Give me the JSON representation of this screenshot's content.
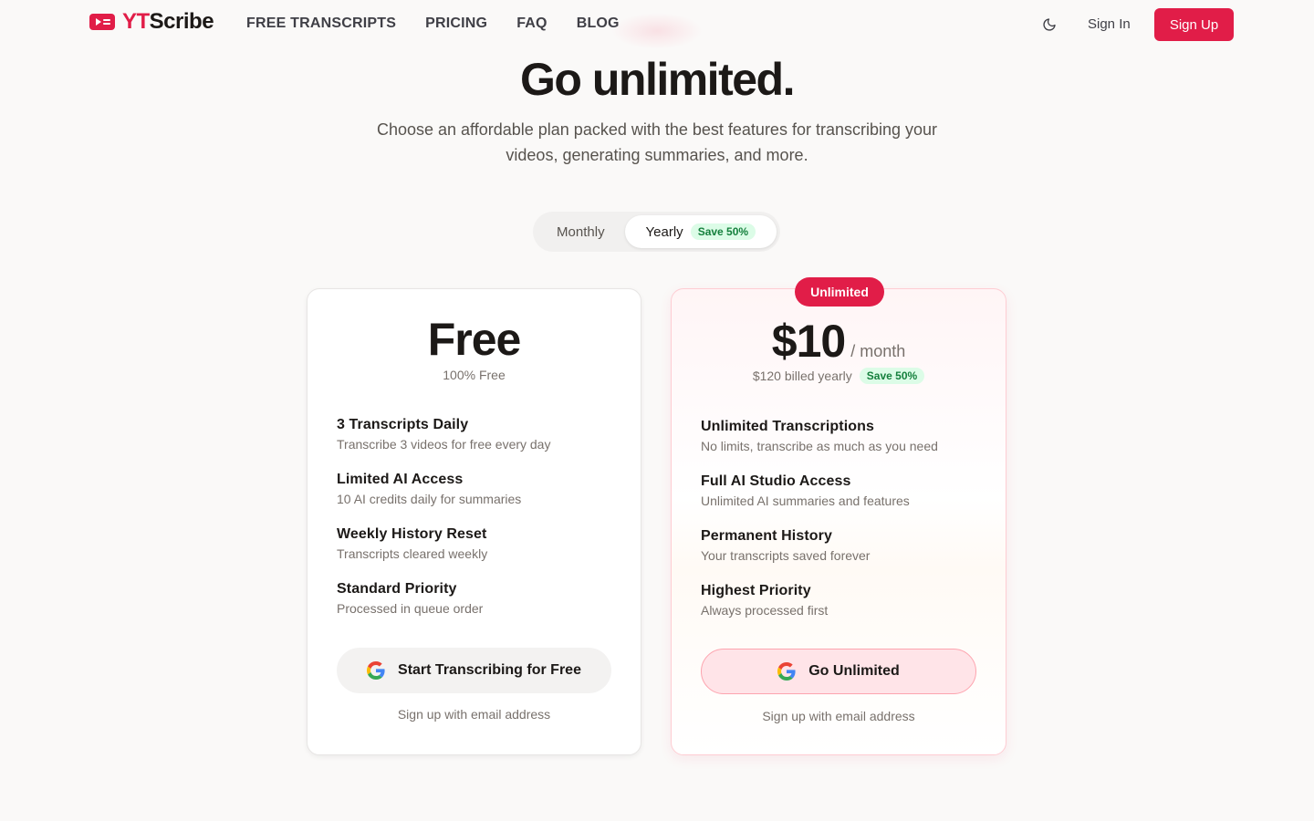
{
  "brand": {
    "name_part1": "YT",
    "name_part2": "Scribe",
    "accent": "#e11d48"
  },
  "nav": {
    "items": [
      "FREE TRANSCRIPTS",
      "PRICING",
      "FAQ",
      "BLOG"
    ]
  },
  "header": {
    "theme_icon": "moon-icon",
    "signin_label": "Sign In",
    "signup_label": "Sign Up"
  },
  "hero": {
    "title": "Go unlimited.",
    "subtitle": "Choose an affordable plan packed with the best features for transcribing your videos, generating summaries, and more."
  },
  "billing_toggle": {
    "monthly": "Monthly",
    "yearly": "Yearly",
    "yearly_badge": "Save 50%",
    "selected": "Yearly"
  },
  "plans": {
    "free": {
      "name": "Free",
      "subtitle": "100% Free",
      "features": [
        {
          "title": "3 Transcripts Daily",
          "desc": "Transcribe 3 videos for free every day"
        },
        {
          "title": "Limited AI Access",
          "desc": "10 AI credits daily for summaries"
        },
        {
          "title": "Weekly History Reset",
          "desc": "Transcripts cleared weekly"
        },
        {
          "title": "Standard Priority",
          "desc": "Processed in queue order"
        }
      ],
      "cta": "Start Transcribing for Free",
      "note": "Sign up with email address"
    },
    "pro": {
      "badge": "Unlimited",
      "price": "$10",
      "per": "/ month",
      "billed": "$120 billed yearly",
      "save_badge": "Save 50%",
      "features": [
        {
          "title": "Unlimited Transcriptions",
          "desc": "No limits, transcribe as much as you need"
        },
        {
          "title": "Full AI Studio Access",
          "desc": "Unlimited AI summaries and features"
        },
        {
          "title": "Permanent History",
          "desc": "Your transcripts saved forever"
        },
        {
          "title": "Highest Priority",
          "desc": "Always processed first"
        }
      ],
      "cta": "Go Unlimited",
      "note": "Sign up with email address"
    }
  },
  "icons": {
    "logo": "youtube-logo-icon",
    "cta": "google-icon"
  }
}
